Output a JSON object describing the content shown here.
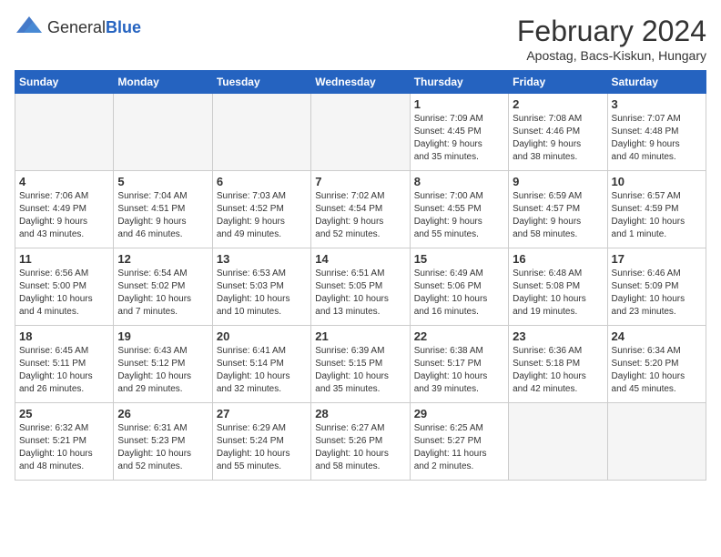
{
  "header": {
    "logo": {
      "text_general": "General",
      "text_blue": "Blue"
    },
    "month": "February 2024",
    "location": "Apostag, Bacs-Kiskun, Hungary"
  },
  "weekdays": [
    "Sunday",
    "Monday",
    "Tuesday",
    "Wednesday",
    "Thursday",
    "Friday",
    "Saturday"
  ],
  "weeks": [
    [
      {
        "day": "",
        "info": ""
      },
      {
        "day": "",
        "info": ""
      },
      {
        "day": "",
        "info": ""
      },
      {
        "day": "",
        "info": ""
      },
      {
        "day": "1",
        "info": "Sunrise: 7:09 AM\nSunset: 4:45 PM\nDaylight: 9 hours\nand 35 minutes."
      },
      {
        "day": "2",
        "info": "Sunrise: 7:08 AM\nSunset: 4:46 PM\nDaylight: 9 hours\nand 38 minutes."
      },
      {
        "day": "3",
        "info": "Sunrise: 7:07 AM\nSunset: 4:48 PM\nDaylight: 9 hours\nand 40 minutes."
      }
    ],
    [
      {
        "day": "4",
        "info": "Sunrise: 7:06 AM\nSunset: 4:49 PM\nDaylight: 9 hours\nand 43 minutes."
      },
      {
        "day": "5",
        "info": "Sunrise: 7:04 AM\nSunset: 4:51 PM\nDaylight: 9 hours\nand 46 minutes."
      },
      {
        "day": "6",
        "info": "Sunrise: 7:03 AM\nSunset: 4:52 PM\nDaylight: 9 hours\nand 49 minutes."
      },
      {
        "day": "7",
        "info": "Sunrise: 7:02 AM\nSunset: 4:54 PM\nDaylight: 9 hours\nand 52 minutes."
      },
      {
        "day": "8",
        "info": "Sunrise: 7:00 AM\nSunset: 4:55 PM\nDaylight: 9 hours\nand 55 minutes."
      },
      {
        "day": "9",
        "info": "Sunrise: 6:59 AM\nSunset: 4:57 PM\nDaylight: 9 hours\nand 58 minutes."
      },
      {
        "day": "10",
        "info": "Sunrise: 6:57 AM\nSunset: 4:59 PM\nDaylight: 10 hours\nand 1 minute."
      }
    ],
    [
      {
        "day": "11",
        "info": "Sunrise: 6:56 AM\nSunset: 5:00 PM\nDaylight: 10 hours\nand 4 minutes."
      },
      {
        "day": "12",
        "info": "Sunrise: 6:54 AM\nSunset: 5:02 PM\nDaylight: 10 hours\nand 7 minutes."
      },
      {
        "day": "13",
        "info": "Sunrise: 6:53 AM\nSunset: 5:03 PM\nDaylight: 10 hours\nand 10 minutes."
      },
      {
        "day": "14",
        "info": "Sunrise: 6:51 AM\nSunset: 5:05 PM\nDaylight: 10 hours\nand 13 minutes."
      },
      {
        "day": "15",
        "info": "Sunrise: 6:49 AM\nSunset: 5:06 PM\nDaylight: 10 hours\nand 16 minutes."
      },
      {
        "day": "16",
        "info": "Sunrise: 6:48 AM\nSunset: 5:08 PM\nDaylight: 10 hours\nand 19 minutes."
      },
      {
        "day": "17",
        "info": "Sunrise: 6:46 AM\nSunset: 5:09 PM\nDaylight: 10 hours\nand 23 minutes."
      }
    ],
    [
      {
        "day": "18",
        "info": "Sunrise: 6:45 AM\nSunset: 5:11 PM\nDaylight: 10 hours\nand 26 minutes."
      },
      {
        "day": "19",
        "info": "Sunrise: 6:43 AM\nSunset: 5:12 PM\nDaylight: 10 hours\nand 29 minutes."
      },
      {
        "day": "20",
        "info": "Sunrise: 6:41 AM\nSunset: 5:14 PM\nDaylight: 10 hours\nand 32 minutes."
      },
      {
        "day": "21",
        "info": "Sunrise: 6:39 AM\nSunset: 5:15 PM\nDaylight: 10 hours\nand 35 minutes."
      },
      {
        "day": "22",
        "info": "Sunrise: 6:38 AM\nSunset: 5:17 PM\nDaylight: 10 hours\nand 39 minutes."
      },
      {
        "day": "23",
        "info": "Sunrise: 6:36 AM\nSunset: 5:18 PM\nDaylight: 10 hours\nand 42 minutes."
      },
      {
        "day": "24",
        "info": "Sunrise: 6:34 AM\nSunset: 5:20 PM\nDaylight: 10 hours\nand 45 minutes."
      }
    ],
    [
      {
        "day": "25",
        "info": "Sunrise: 6:32 AM\nSunset: 5:21 PM\nDaylight: 10 hours\nand 48 minutes."
      },
      {
        "day": "26",
        "info": "Sunrise: 6:31 AM\nSunset: 5:23 PM\nDaylight: 10 hours\nand 52 minutes."
      },
      {
        "day": "27",
        "info": "Sunrise: 6:29 AM\nSunset: 5:24 PM\nDaylight: 10 hours\nand 55 minutes."
      },
      {
        "day": "28",
        "info": "Sunrise: 6:27 AM\nSunset: 5:26 PM\nDaylight: 10 hours\nand 58 minutes."
      },
      {
        "day": "29",
        "info": "Sunrise: 6:25 AM\nSunset: 5:27 PM\nDaylight: 11 hours\nand 2 minutes."
      },
      {
        "day": "",
        "info": ""
      },
      {
        "day": "",
        "info": ""
      }
    ]
  ]
}
